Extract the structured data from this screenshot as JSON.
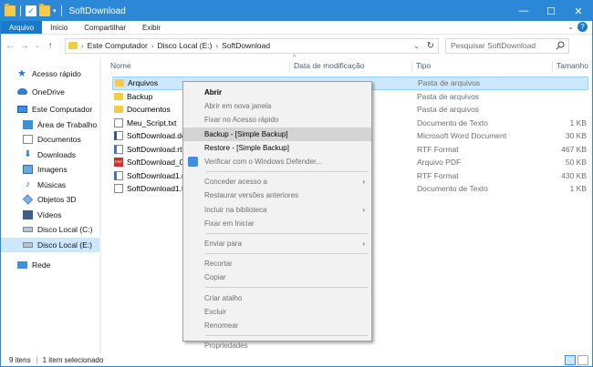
{
  "window": {
    "title": "SoftDownload",
    "accent": "#2b88d8"
  },
  "titlebar": {
    "minimize_icon": "minimize-icon",
    "maximize_icon": "maximize-icon",
    "close_icon": "close-icon"
  },
  "ribbon": {
    "tabs": [
      "Arquivo",
      "Início",
      "Compartilhar",
      "Exibir"
    ],
    "expand_icon": "chevron-down-icon",
    "help": "?"
  },
  "address": {
    "crumbs": [
      "Este Computador",
      "Disco Local (E:)",
      "SoftDownload"
    ],
    "search_placeholder": "Pesquisar SoftDownload"
  },
  "nav_pane": {
    "items": [
      {
        "label": "Acesso rápido",
        "icon": "star-icon"
      },
      {
        "label": "OneDrive",
        "icon": "cloud-icon"
      },
      {
        "label": "Este Computador",
        "icon": "computer-icon"
      },
      {
        "label": "Área de Trabalho",
        "icon": "desktop-icon"
      },
      {
        "label": "Documentos",
        "icon": "documents-icon"
      },
      {
        "label": "Downloads",
        "icon": "download-icon"
      },
      {
        "label": "Imagens",
        "icon": "pictures-icon"
      },
      {
        "label": "Músicas",
        "icon": "music-icon"
      },
      {
        "label": "Objetos 3D",
        "icon": "cube-icon"
      },
      {
        "label": "Vídeos",
        "icon": "video-icon"
      },
      {
        "label": "Disco Local (C:)",
        "icon": "drive-icon"
      },
      {
        "label": "Disco Local (E:)",
        "icon": "drive-icon"
      },
      {
        "label": "Rede",
        "icon": "network-icon"
      }
    ]
  },
  "columns": {
    "name": "Nome",
    "date": "Data de modificação",
    "type": "Tipo",
    "size": "Tamanho"
  },
  "files": [
    {
      "name": "Arquivos",
      "date": "",
      "type": "Pasta de arquivos",
      "size": "",
      "icon": "folder-icon"
    },
    {
      "name": "Backup",
      "date": "",
      "type": "Pasta de arquivos",
      "size": "",
      "icon": "folder-icon"
    },
    {
      "name": "Documentos",
      "date": "",
      "type": "Pasta de arquivos",
      "size": "",
      "icon": "folder-icon"
    },
    {
      "name": "Meu_Script.txt",
      "date": "",
      "type": "Documento de Texto",
      "size": "1 KB",
      "icon": "text-file-icon"
    },
    {
      "name": "SoftDownload.docx",
      "date": "",
      "type": "Microsoft Word Document",
      "size": "30 KB",
      "icon": "word-file-icon"
    },
    {
      "name": "SoftDownload.rtf",
      "date": "",
      "type": "RTF Format",
      "size": "467 KB",
      "icon": "rtf-file-icon"
    },
    {
      "name": "SoftDownload_01.pdf",
      "date": "",
      "type": "Arquivo PDF",
      "size": "50 KB",
      "icon": "pdf-file-icon"
    },
    {
      "name": "SoftDownload1.rtf",
      "date": "",
      "type": "RTF Format",
      "size": "430 KB",
      "icon": "rtf-file-icon"
    },
    {
      "name": "SoftDownload1.txt",
      "date": "",
      "type": "Documento de Texto",
      "size": "1 KB",
      "icon": "text-file-icon"
    }
  ],
  "context_menu": {
    "items": [
      {
        "label": "Abrir",
        "bold": true
      },
      {
        "label": "Abrir em nova janela"
      },
      {
        "label": "Fixar no Acesso rápido"
      },
      {
        "label": "Backup - [Simple Backup]",
        "highlight": true
      },
      {
        "label": "Restore - [Simple Backup]"
      },
      {
        "label": "Verificar com o Windows Defender...",
        "icon": "defender-icon"
      },
      {
        "sep": true
      },
      {
        "label": "Conceder acesso a",
        "submenu": true
      },
      {
        "label": "Restaurar versões anteriores"
      },
      {
        "label": "Incluir na biblioteca",
        "submenu": true
      },
      {
        "label": "Fixar em Iniciar"
      },
      {
        "sep": true
      },
      {
        "label": "Enviar para",
        "submenu": true
      },
      {
        "sep": true
      },
      {
        "label": "Recortar"
      },
      {
        "label": "Copiar"
      },
      {
        "sep": true
      },
      {
        "label": "Criar atalho"
      },
      {
        "label": "Excluir"
      },
      {
        "label": "Renomear"
      },
      {
        "sep": true
      },
      {
        "label": "Propriedades"
      }
    ]
  },
  "status": {
    "count": "9 itens",
    "selected": "1 item selecionado"
  }
}
